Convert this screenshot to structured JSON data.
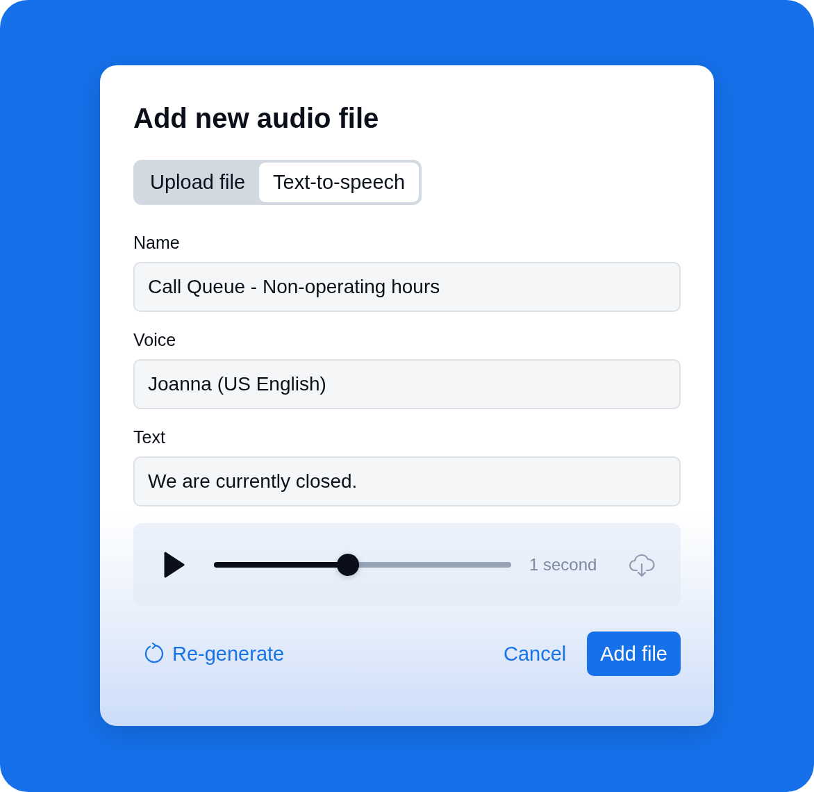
{
  "dialog": {
    "title": "Add new audio file"
  },
  "tabs": [
    {
      "label": "Upload file",
      "selected": false
    },
    {
      "label": "Text-to-speech",
      "selected": true
    }
  ],
  "fields": [
    {
      "label": "Name",
      "value": "Call Queue - Non-operating hours"
    },
    {
      "label": "Voice",
      "value": "Joanna (US English)"
    },
    {
      "label": "Text",
      "value": "We are currently closed."
    }
  ],
  "player": {
    "level": 0.45,
    "duration": "1 second"
  },
  "footer": {
    "regenerate": "Re-generate",
    "cancel": "Cancel",
    "submit": "Add file"
  }
}
